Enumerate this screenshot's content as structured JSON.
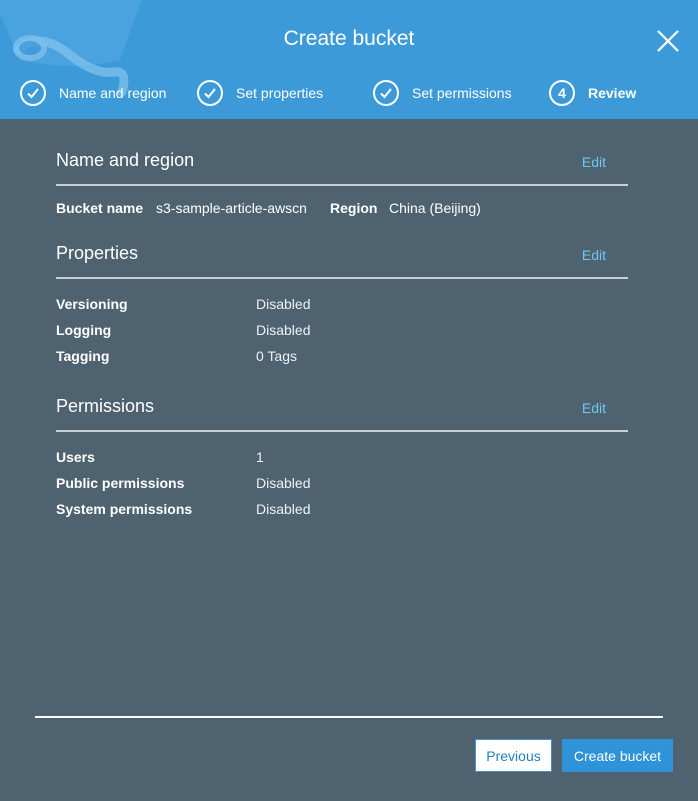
{
  "dialog": {
    "title": "Create bucket"
  },
  "steps": [
    {
      "label": "Name and region",
      "state": "complete"
    },
    {
      "label": "Set properties",
      "state": "complete"
    },
    {
      "label": "Set permissions",
      "state": "complete"
    },
    {
      "label": "Review",
      "number": "4",
      "state": "active"
    }
  ],
  "sections": {
    "name_region": {
      "title": "Name and region",
      "edit": "Edit",
      "bucket_name_label": "Bucket name",
      "bucket_name_value": "s3-sample-article-awscn",
      "region_label": "Region",
      "region_value": "China (Beijing)"
    },
    "properties": {
      "title": "Properties",
      "edit": "Edit",
      "rows": [
        {
          "label": "Versioning",
          "value": "Disabled"
        },
        {
          "label": "Logging",
          "value": "Disabled"
        },
        {
          "label": "Tagging",
          "value": "0 Tags"
        }
      ]
    },
    "permissions": {
      "title": "Permissions",
      "edit": "Edit",
      "rows": [
        {
          "label": "Users",
          "value": "1"
        },
        {
          "label": "Public permissions",
          "value": "Disabled"
        },
        {
          "label": "System permissions",
          "value": "Disabled"
        }
      ]
    }
  },
  "footer": {
    "previous": "Previous",
    "create": "Create bucket"
  },
  "colors": {
    "header": "#3d9ad9",
    "body": "#4e6270",
    "link": "#6ec8f2",
    "primary_button": "#2e93d8"
  }
}
